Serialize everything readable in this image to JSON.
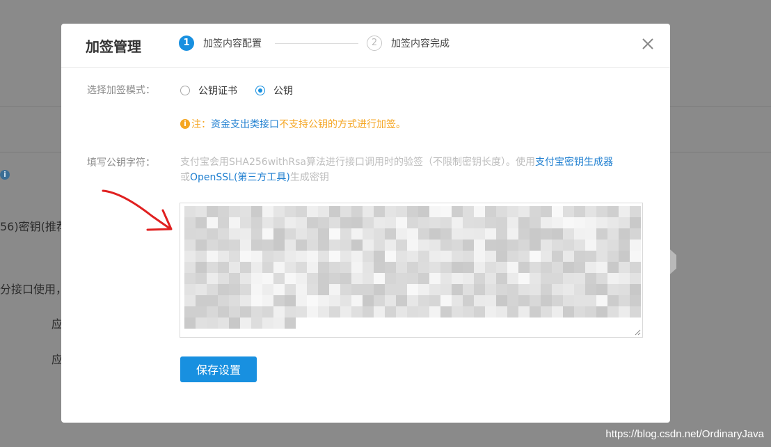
{
  "background": {
    "texts": [
      "56)密钥(推荐",
      "分接口使用，",
      "应",
      "应"
    ]
  },
  "dialog": {
    "title": "加签管理",
    "steps": [
      {
        "number": "1",
        "label": "加签内容配置",
        "state": "active"
      },
      {
        "number": "2",
        "label": "加签内容完成",
        "state": "inactive"
      }
    ],
    "mode_label": "选择加签模式：",
    "radio_options": [
      {
        "label": "公钥证书",
        "checked": false
      },
      {
        "label": "公钥",
        "checked": true
      }
    ],
    "note": {
      "icon": "info-icon",
      "prefix": "注：",
      "link": "资金支出类接口",
      "suffix": "不支持公钥的方式进行加签。"
    },
    "key_label": "填写公钥字符：",
    "description": {
      "text1": "支付宝会用SHA256withRsa算法进行接口调用时的验签（不限制密钥长度）。使用",
      "link1": "支付宝密钥生成器",
      "text2": "或",
      "link2": "OpenSSL(第三方工具)",
      "text3": "生成密钥"
    },
    "save_label": "保存设置"
  },
  "watermark": "https://blog.csdn.net/OrdinaryJava",
  "colors": {
    "accent": "#1890e0",
    "warning": "#f5a623",
    "link": "#1f7fd0",
    "overlay": "#8a8a8a"
  }
}
